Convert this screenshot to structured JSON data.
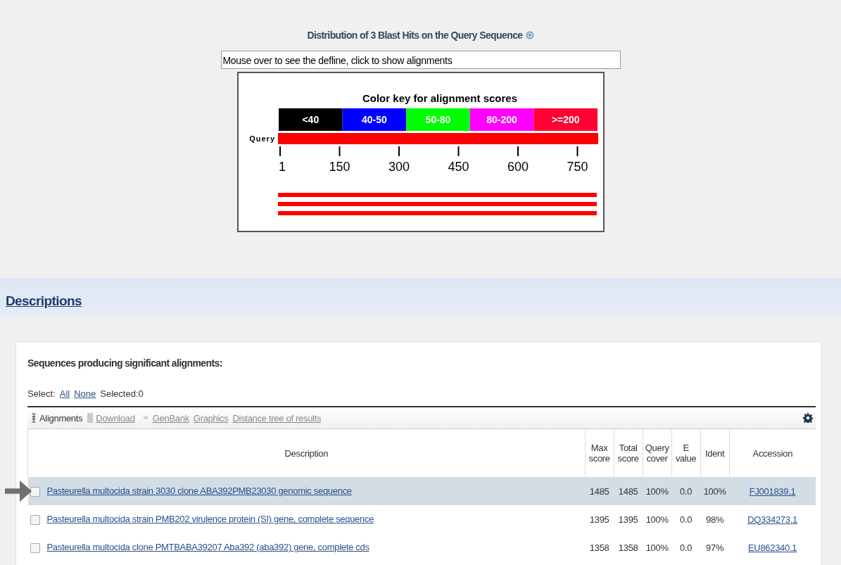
{
  "graphic_summary": {
    "title": "Distribution of 3 Blast Hits on the Query Sequence",
    "defline_hint": "Mouse over to see the defline, click to show alignments",
    "color_key": {
      "title": "Color key for alignment scores",
      "bins": [
        {
          "label": "<40",
          "color": "#000000"
        },
        {
          "label": "40-50",
          "color": "#0000ff"
        },
        {
          "label": "50-80",
          "color": "#00ff00"
        },
        {
          "label": "80-200",
          "color": "#ff00ff"
        },
        {
          "label": ">=200",
          "color": "#ff0033"
        }
      ]
    },
    "query_label": "Query",
    "ticks": [
      "1",
      "150",
      "300",
      "450",
      "600",
      "750"
    ],
    "hits": [
      {
        "color": "#ff0000"
      },
      {
        "color": "#ff0000"
      },
      {
        "color": "#ff0000"
      }
    ]
  },
  "descriptions_link": "Descriptions",
  "results": {
    "heading": "Sequences producing significant alignments:",
    "select_label": "Select:",
    "select_all": "All",
    "select_none": "None",
    "selected_count": "Selected:0",
    "toolbar": [
      {
        "label": "Alignments",
        "disabled": false,
        "kind": "sort"
      },
      {
        "label": "Download",
        "disabled": true,
        "kind": "menu"
      },
      {
        "label": "GenBank",
        "disabled": true,
        "kind": "link"
      },
      {
        "label": "Graphics",
        "disabled": true,
        "kind": "link"
      },
      {
        "label": "Distance tree of results",
        "disabled": true,
        "kind": "link"
      }
    ],
    "columns": [
      "Description",
      "Max score",
      "Total score",
      "Query cover",
      "E value",
      "Ident",
      "Accession"
    ],
    "rows": [
      {
        "checked": false,
        "selected": true,
        "pointed": true,
        "cells": [
          "Pasteurella multocida strain 3030 clone ABA392PMB23030 genomic sequence",
          "1485",
          "1485",
          "100%",
          "0.0",
          "100%",
          "FJ001839.1"
        ]
      },
      {
        "checked": false,
        "selected": false,
        "pointed": false,
        "cells": [
          "Pasteurella multocida strain PMB202 virulence protein (SI) gene, complete sequence",
          "1395",
          "1395",
          "100%",
          "0.0",
          "98%",
          "DQ334273.1"
        ]
      },
      {
        "checked": false,
        "selected": false,
        "pointed": false,
        "cells": [
          "Pasteurella multocida clone PMTBABA39207 Aba392 (aba392) gene, complete cds",
          "1358",
          "1358",
          "100%",
          "0.0",
          "97%",
          "EU862340.1"
        ]
      }
    ]
  }
}
